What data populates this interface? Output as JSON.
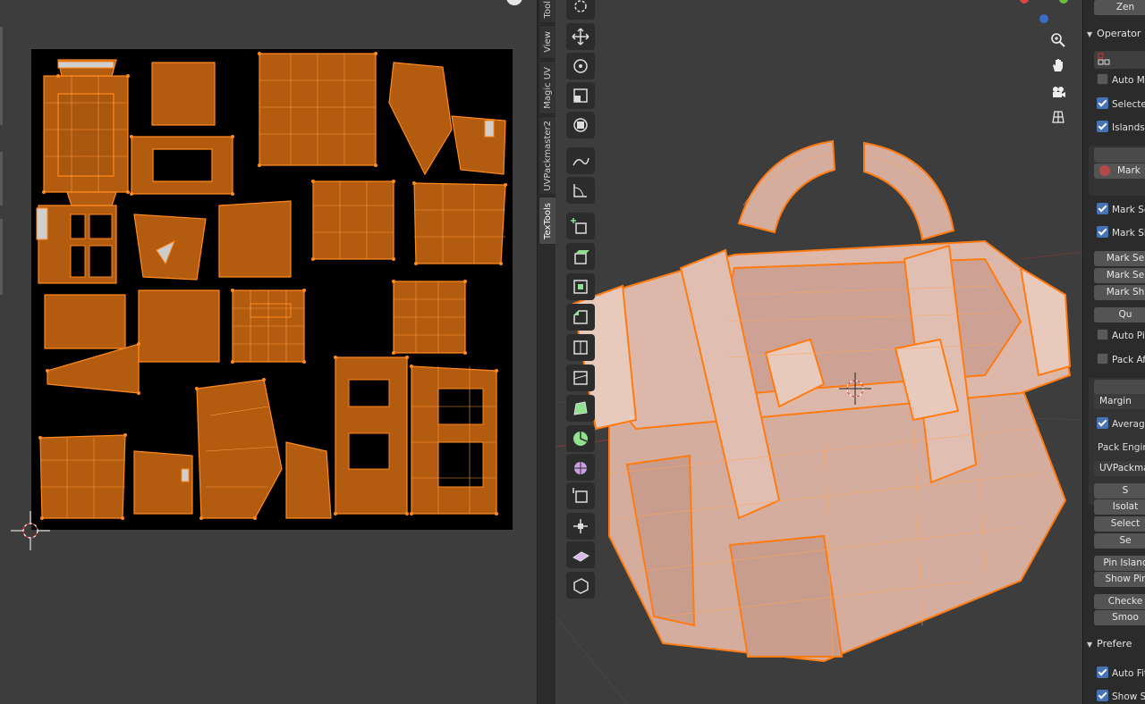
{
  "side_tabs": [
    {
      "label": "Tool"
    },
    {
      "label": "View"
    },
    {
      "label": "Magic UV"
    },
    {
      "label": "UVPackmaster2"
    },
    {
      "label": "TexTools"
    }
  ],
  "toolbar_tools": [
    "cursor-icon",
    "move-icon",
    "rotate-icon",
    "scale-icon",
    "transform-icon",
    "annotate-icon",
    "measure-icon",
    "add-cube-icon",
    "extrude-region-icon",
    "inset-faces-icon",
    "bevel-icon",
    "loop-cut-icon",
    "knife-icon",
    "poly-build-icon",
    "spin-icon",
    "smooth-icon",
    "edge-slide-icon",
    "shrink-fatten-icon",
    "shear-icon",
    "rip-region-icon"
  ],
  "n_panel": {
    "top_button": "Zen",
    "operator_header": "Operator",
    "auto_mark_label": "Auto Ma",
    "selected_label": "Selected",
    "islands_label": "Islands C",
    "mark_button": "Mark",
    "mark_seams_label": "Mark Sea",
    "mark_sharp_label": "Mark Sha",
    "mark_se_1": "Mark Se",
    "mark_se_2": "Mark Se",
    "mark_sh": "Mark Sh",
    "qu_button": "Qu",
    "auto_pin_label": "Auto Pin",
    "pack_after_label": "Pack Aft",
    "margin_label": "Margin",
    "average_label": "Average",
    "pack_engine_label": "Pack Engin",
    "uvpackmaster_label": "UVPackma",
    "s_button": "S",
    "isolate_button": "Isolat",
    "select_button": "Select",
    "sel_button": "Se",
    "pin_islands_button": "Pin Islanc",
    "show_pinned_button": "Show Pir",
    "check_button": "Checke",
    "smooth_button": "Smoo",
    "preferences_header": "Prefere",
    "auto_fit_label": "Auto Fit",
    "show_se_label": "Show Se"
  },
  "colors": {
    "uv_fill": "#b35b0f",
    "uv_edge": "#ff8a1e",
    "mesh_fill": "#d8b2a4",
    "mesh_edge": "#ff8000",
    "checkbox_on": "#4772b3"
  }
}
